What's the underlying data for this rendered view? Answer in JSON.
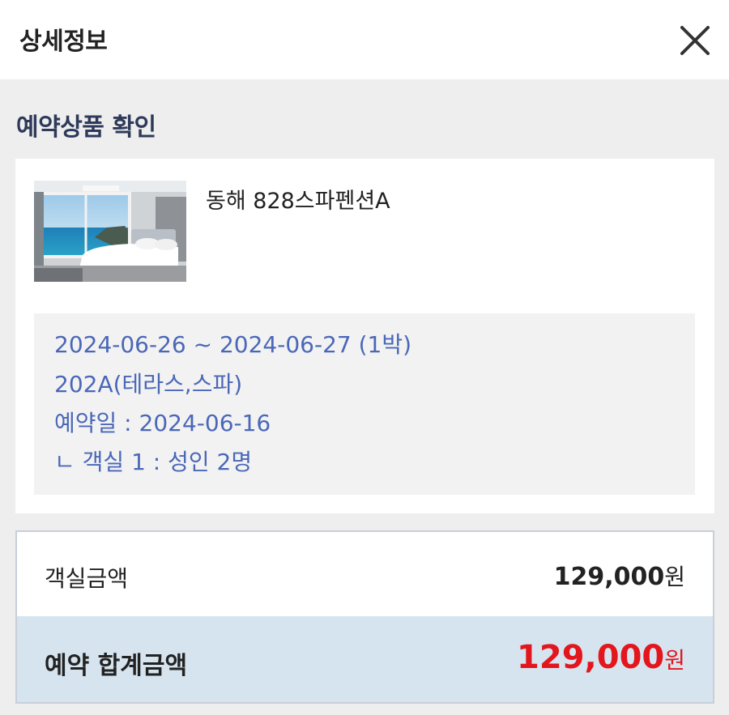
{
  "header": {
    "title": "상세정보"
  },
  "section": {
    "title": "예약상품 확인"
  },
  "product": {
    "name": "동해 828스파펜션A",
    "image_alt": "ocean-view bedroom photo"
  },
  "booking": {
    "dates": "2024-06-26 ~ 2024-06-27 (1박)",
    "room": "202A(테라스,스파)",
    "reservation_date": "예약일 : 2024-06-16",
    "guests": "ㄴ 객실 1 : 성인 2명"
  },
  "pricing": {
    "room_label": "객실금액",
    "room_amount": "129,000",
    "room_currency": "원",
    "total_label": "예약 합계금액",
    "total_amount": "129,000",
    "total_currency": "원"
  },
  "colors": {
    "accent_blue": "#4a67b8",
    "title_navy": "#2e3a59",
    "total_red": "#e3161d",
    "total_row_bg": "#d6e4ef"
  }
}
